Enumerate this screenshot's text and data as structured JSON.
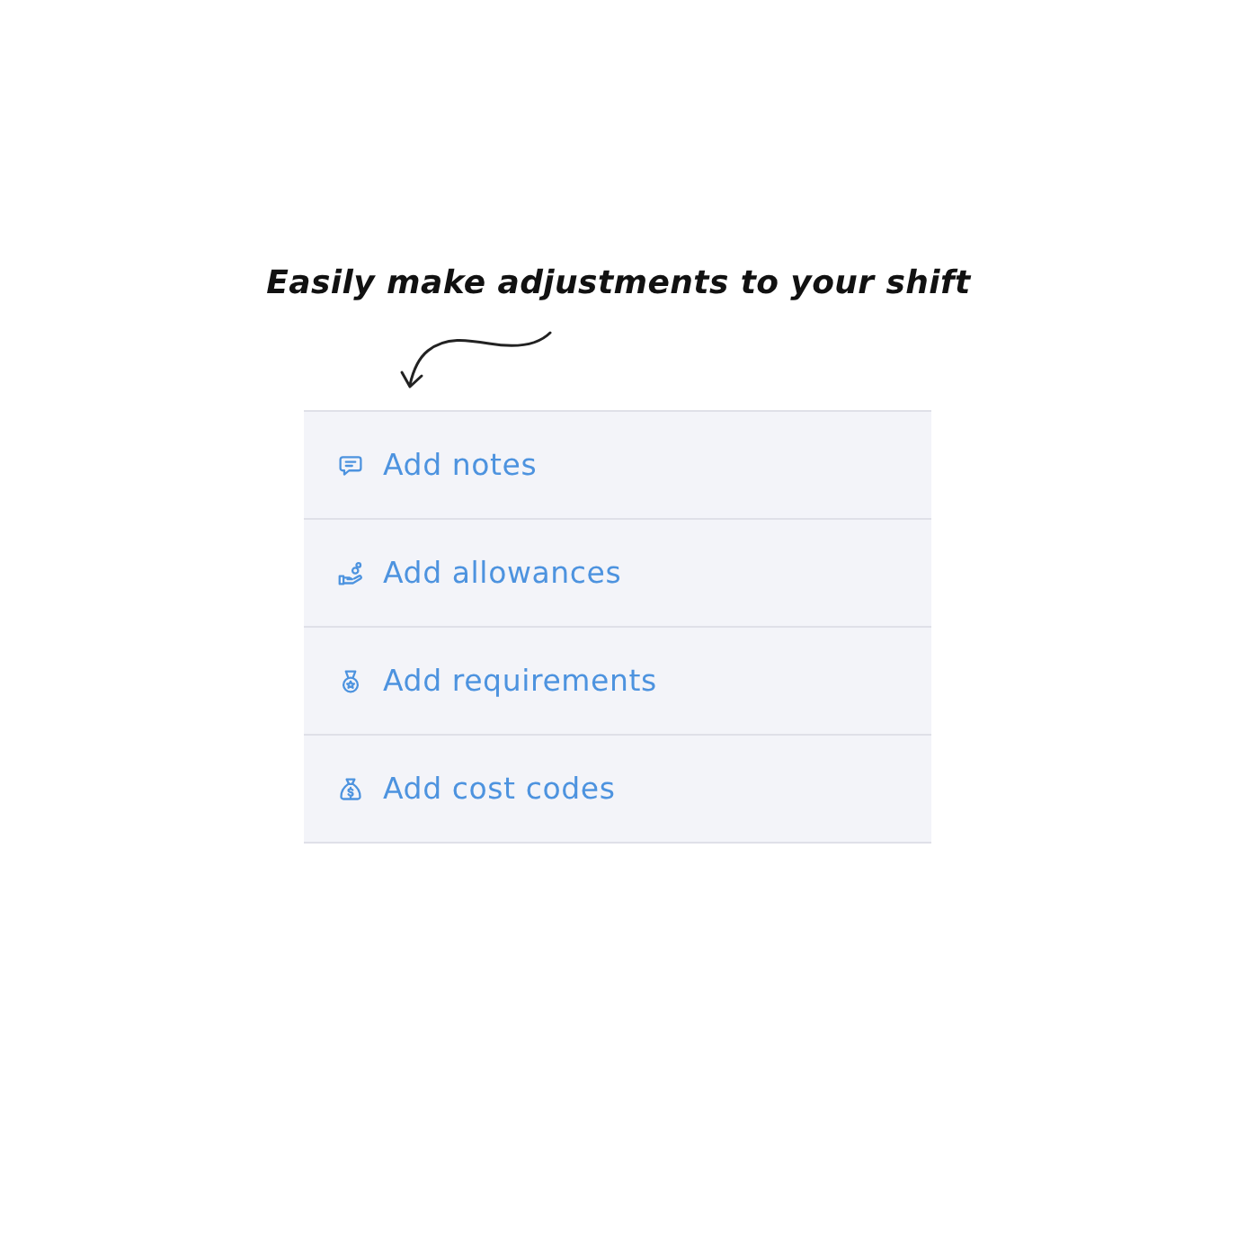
{
  "caption": "Easily make adjustments to your shift",
  "actions": [
    {
      "label": "Add notes"
    },
    {
      "label": "Add allowances"
    },
    {
      "label": "Add requirements"
    },
    {
      "label": "Add cost codes"
    }
  ]
}
